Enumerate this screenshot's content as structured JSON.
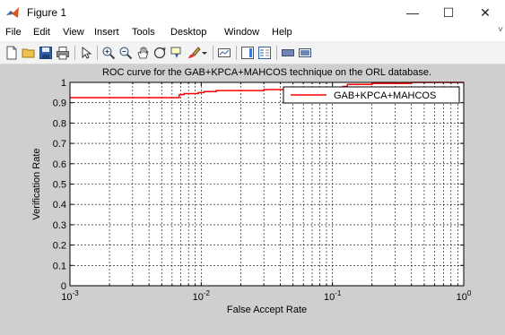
{
  "window": {
    "title": "Figure 1",
    "controls": {
      "minimize": "—",
      "maximize": "☐",
      "close": "✕"
    }
  },
  "menu": {
    "items": [
      "File",
      "Edit",
      "View",
      "Insert",
      "Tools",
      "Desktop",
      "Window",
      "Help"
    ],
    "overflow": "˅"
  },
  "toolbar": {
    "buttons": [
      "new-figure-icon",
      "open-file-icon",
      "save-icon",
      "print-icon",
      "pointer-icon",
      "zoom-in-icon",
      "zoom-out-icon",
      "pan-icon",
      "rotate-3d-icon",
      "data-cursor-icon",
      "brush-icon",
      "brush-dropdown-icon",
      "link-plot-icon",
      "colorbar-icon",
      "legend-icon",
      "hide-plot-tools-icon",
      "show-plot-tools-icon"
    ]
  },
  "colors": {
    "figure_bg": "#cfcfcf",
    "axes_bg": "#ffffff",
    "curve": "#ff0000"
  },
  "chart_data": {
    "type": "line",
    "title": "ROC curve for the GAB+KPCA+MAHCOS technique on the ORL database.",
    "xlabel": "False Accept Rate",
    "ylabel": "Verification Rate",
    "xscale": "log",
    "xlim": [
      0.001,
      1
    ],
    "ylim": [
      0,
      1
    ],
    "xticks": [
      {
        "value": 0.001,
        "base": "10",
        "exp": "-3"
      },
      {
        "value": 0.01,
        "base": "10",
        "exp": "-2"
      },
      {
        "value": 0.1,
        "base": "10",
        "exp": "-1"
      },
      {
        "value": 1,
        "base": "10",
        "exp": "0"
      }
    ],
    "yticks": [
      "0",
      "0.1",
      "0.2",
      "0.3",
      "0.4",
      "0.5",
      "0.6",
      "0.7",
      "0.8",
      "0.9",
      "1"
    ],
    "grid": true,
    "legend_position": "top-right",
    "series": [
      {
        "name": "GAB+KPCA+MAHCOS",
        "color": "#ff0000",
        "x": [
          0.001,
          0.0063,
          0.0068,
          0.0074,
          0.0086,
          0.0095,
          0.0105,
          0.012,
          0.013,
          0.03,
          0.055,
          0.1,
          0.11,
          0.12,
          0.13,
          0.2,
          0.4,
          1.0
        ],
        "y": [
          0.925,
          0.925,
          0.94,
          0.945,
          0.945,
          0.95,
          0.955,
          0.955,
          0.96,
          0.965,
          0.97,
          0.97,
          0.975,
          0.98,
          0.99,
          0.995,
          1.0,
          1.0
        ]
      }
    ]
  }
}
